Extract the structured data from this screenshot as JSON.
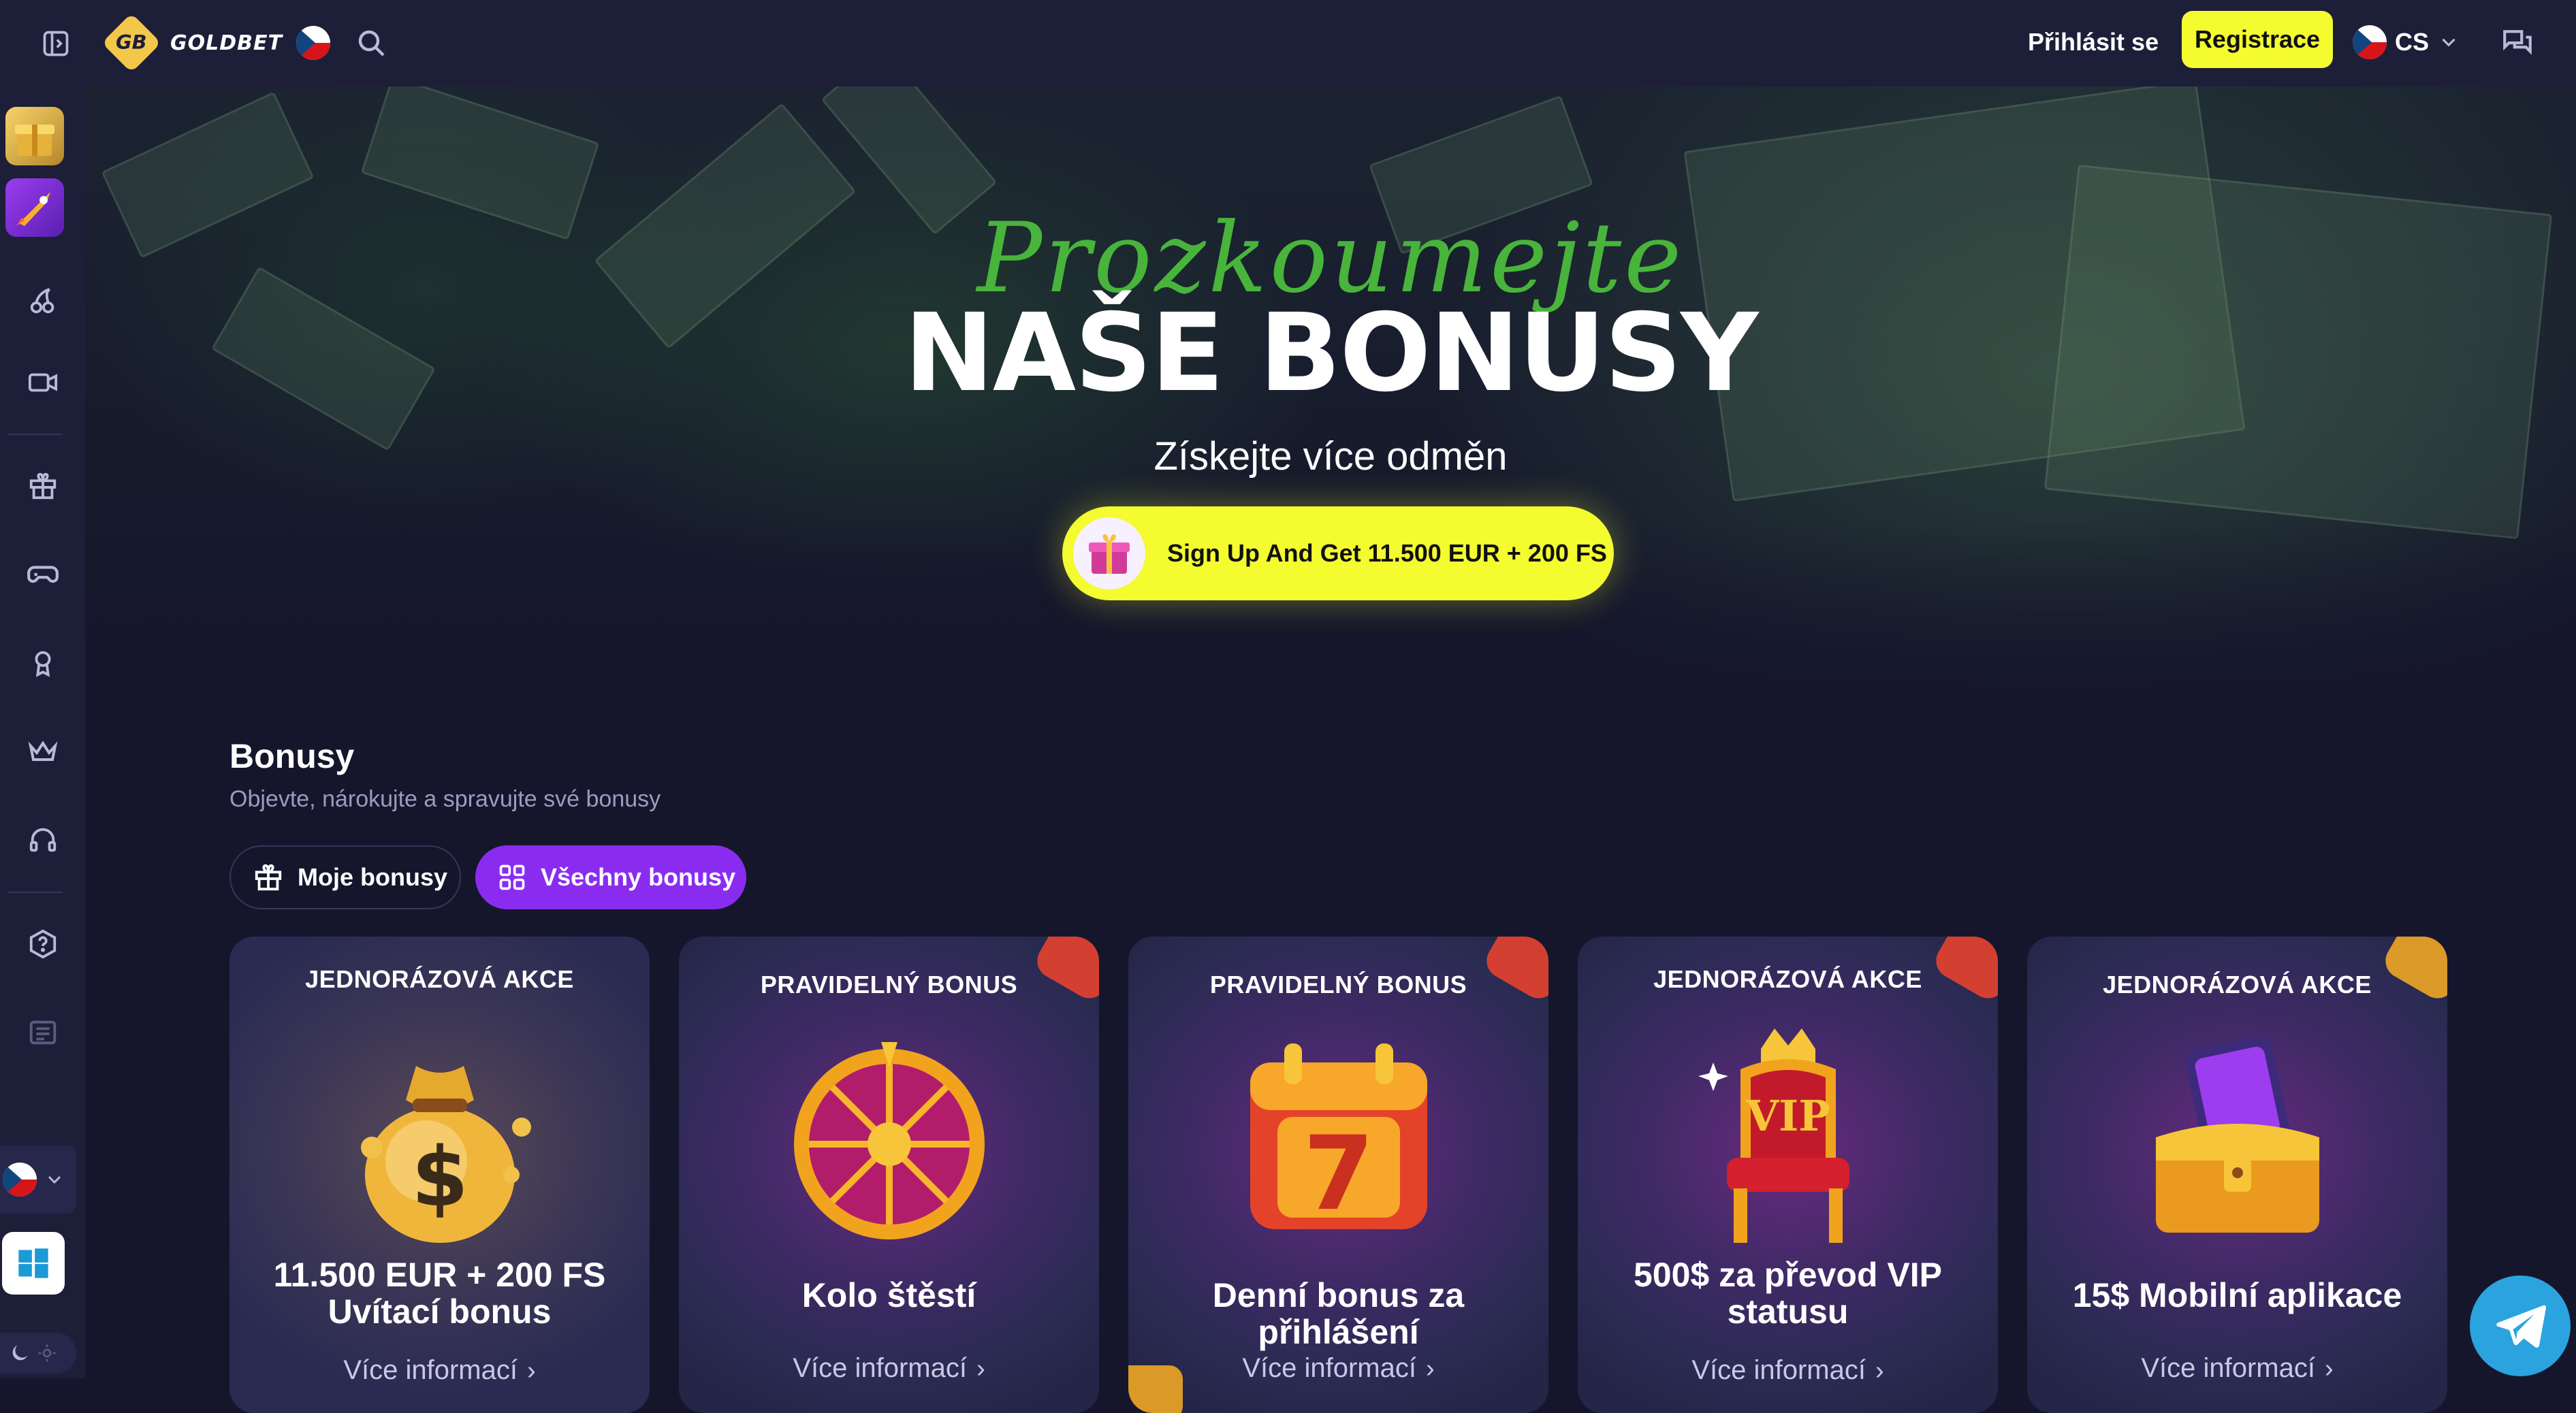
{
  "header": {
    "brand_logo_mark": "GB",
    "brand_name": "GOLDBET",
    "login_label": "Přihlásit se",
    "register_label": "Registrace",
    "language_code": "CS"
  },
  "hero": {
    "script_text": "Prozkoumejte",
    "title": "NAŠE BONUSY",
    "subtitle": "Získejte více odměn",
    "cta_label": "Sign Up And Get 11.500 EUR + 200 FS"
  },
  "bonuses": {
    "title": "Bonusy",
    "subtitle": "Objevte, nárokujte a spravujte své bonusy",
    "tabs": [
      {
        "label": "Moje bonusy",
        "active": false
      },
      {
        "label": "Všechny bonusy",
        "active": true
      }
    ],
    "cards": [
      {
        "type": "JEDNORÁZOVÁ AKCE",
        "title": "11.500 EUR + 200 FS Uvítací bonus",
        "more": "Více informací",
        "icon": "money-bag-icon"
      },
      {
        "type": "PRAVIDELNÝ BONUS",
        "title": "Kolo štěstí",
        "more": "Více informací",
        "icon": "fortune-wheel-icon"
      },
      {
        "type": "PRAVIDELNÝ BONUS",
        "title": "Denní bonus za přihlášení",
        "more": "Více informací",
        "icon": "calendar-7-icon"
      },
      {
        "type": "JEDNORÁZOVÁ AKCE",
        "title": "500$ za převod VIP statusu",
        "more": "Více informací",
        "icon": "vip-throne-icon"
      },
      {
        "type": "JEDNORÁZOVÁ AKCE",
        "title": "15$ Mobilní aplikace",
        "more": "Více informací",
        "icon": "treasure-chest-phone-icon"
      }
    ]
  },
  "colors": {
    "accent_yellow": "#f4fb2f",
    "accent_purple": "#8a2cf0",
    "background": "#15162b",
    "sidebar": "#1d1e38",
    "hero_script_green": "#48b43b",
    "telegram_blue": "#2aa3df"
  }
}
